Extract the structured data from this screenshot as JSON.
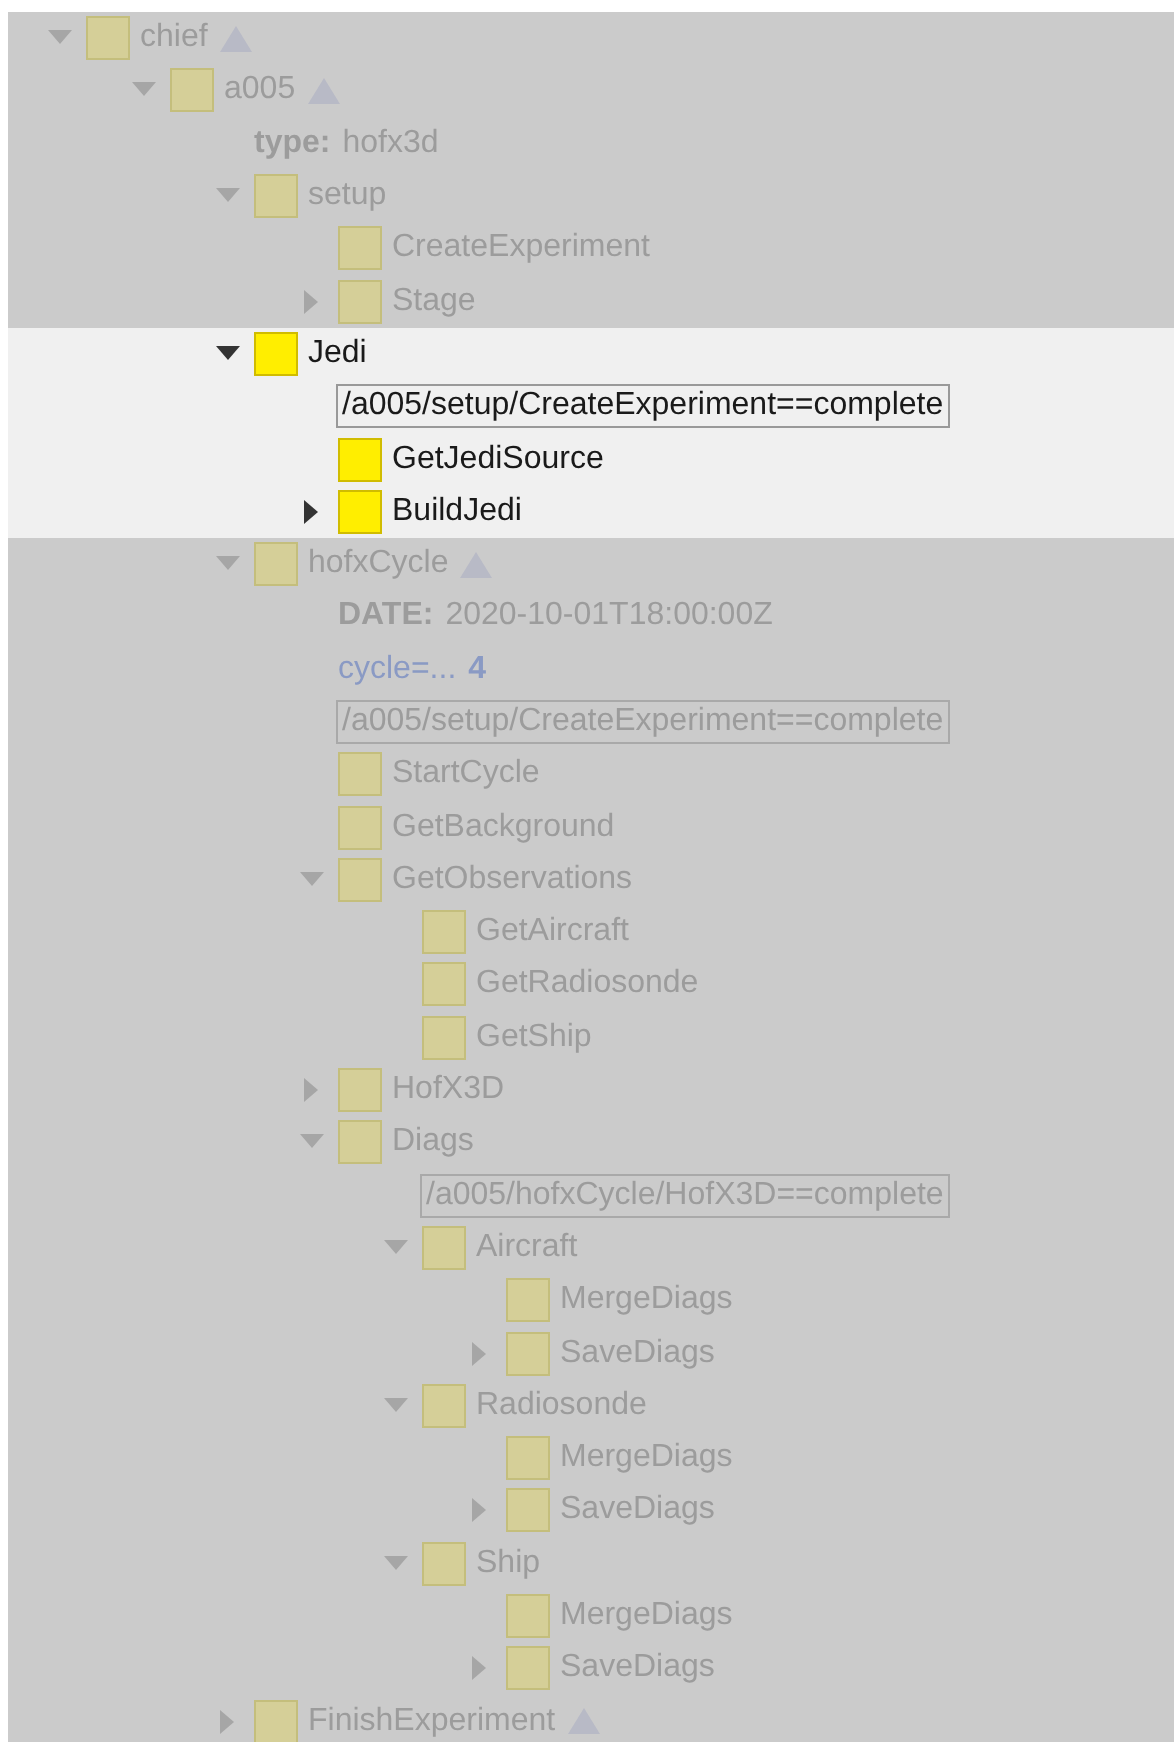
{
  "tree": [
    {
      "kind": "node",
      "name": "chief",
      "expanded": true,
      "marked": true,
      "highlighted": false,
      "children": [
        {
          "kind": "node",
          "name": "a005",
          "expanded": true,
          "marked": true,
          "highlighted": false,
          "children": [
            {
              "kind": "variable",
              "label": "type:",
              "value": "hofx3d"
            },
            {
              "kind": "node",
              "name": "setup",
              "expanded": true,
              "marked": false,
              "highlighted": false,
              "children": [
                {
                  "kind": "node",
                  "name": "CreateExperiment",
                  "marked": false,
                  "highlighted": false
                },
                {
                  "kind": "node",
                  "name": "Stage",
                  "expanded": false,
                  "marked": false,
                  "highlighted": false
                }
              ]
            },
            {
              "kind": "node",
              "name": "Jedi",
              "expanded": true,
              "marked": false,
              "highlighted": true,
              "children": [
                {
                  "kind": "trigger",
                  "text": "/a005/setup/CreateExperiment==complete"
                },
                {
                  "kind": "node",
                  "name": "GetJediSource",
                  "marked": false,
                  "highlighted": false
                },
                {
                  "kind": "node",
                  "name": "BuildJedi",
                  "expanded": false,
                  "marked": false,
                  "highlighted": false
                }
              ]
            },
            {
              "kind": "node",
              "name": "hofxCycle",
              "expanded": true,
              "marked": true,
              "highlighted": false,
              "children": [
                {
                  "kind": "variable",
                  "label": "DATE:",
                  "value": "2020-10-01T18:00:00Z"
                },
                {
                  "kind": "repeat",
                  "label": "cycle=...",
                  "value": "4"
                },
                {
                  "kind": "trigger",
                  "text": "/a005/setup/CreateExperiment==complete"
                },
                {
                  "kind": "node",
                  "name": "StartCycle",
                  "marked": false,
                  "highlighted": false
                },
                {
                  "kind": "node",
                  "name": "GetBackground",
                  "marked": false,
                  "highlighted": false
                },
                {
                  "kind": "node",
                  "name": "GetObservations",
                  "expanded": true,
                  "marked": false,
                  "highlighted": false,
                  "children": [
                    {
                      "kind": "node",
                      "name": "GetAircraft",
                      "marked": false,
                      "highlighted": false
                    },
                    {
                      "kind": "node",
                      "name": "GetRadiosonde",
                      "marked": false,
                      "highlighted": false
                    },
                    {
                      "kind": "node",
                      "name": "GetShip",
                      "marked": false,
                      "highlighted": false
                    }
                  ]
                },
                {
                  "kind": "node",
                  "name": "HofX3D",
                  "expanded": false,
                  "marked": false,
                  "highlighted": false
                },
                {
                  "kind": "node",
                  "name": "Diags",
                  "expanded": true,
                  "marked": false,
                  "highlighted": false,
                  "children": [
                    {
                      "kind": "trigger",
                      "text": "/a005/hofxCycle/HofX3D==complete"
                    },
                    {
                      "kind": "node",
                      "name": "Aircraft",
                      "expanded": true,
                      "marked": false,
                      "highlighted": false,
                      "children": [
                        {
                          "kind": "node",
                          "name": "MergeDiags",
                          "marked": false,
                          "highlighted": false
                        },
                        {
                          "kind": "node",
                          "name": "SaveDiags",
                          "expanded": false,
                          "marked": false,
                          "highlighted": false
                        }
                      ]
                    },
                    {
                      "kind": "node",
                      "name": "Radiosonde",
                      "expanded": true,
                      "marked": false,
                      "highlighted": false,
                      "children": [
                        {
                          "kind": "node",
                          "name": "MergeDiags",
                          "marked": false,
                          "highlighted": false
                        },
                        {
                          "kind": "node",
                          "name": "SaveDiags",
                          "expanded": false,
                          "marked": false,
                          "highlighted": false
                        }
                      ]
                    },
                    {
                      "kind": "node",
                      "name": "Ship",
                      "expanded": true,
                      "marked": false,
                      "highlighted": false,
                      "children": [
                        {
                          "kind": "node",
                          "name": "MergeDiags",
                          "marked": false,
                          "highlighted": false
                        },
                        {
                          "kind": "node",
                          "name": "SaveDiags",
                          "expanded": false,
                          "marked": false,
                          "highlighted": false
                        }
                      ]
                    }
                  ]
                }
              ]
            },
            {
              "kind": "node",
              "name": "FinishExperiment",
              "expanded": false,
              "marked": true,
              "highlighted": false
            }
          ]
        }
      ]
    }
  ]
}
